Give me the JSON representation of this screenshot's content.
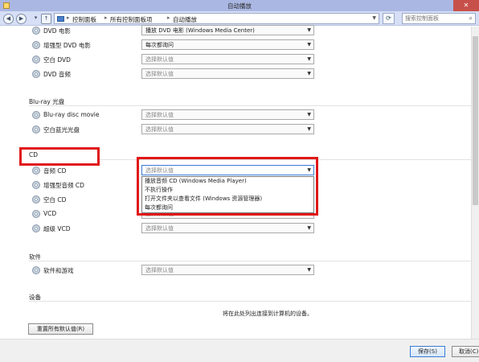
{
  "window": {
    "title": "自动播放"
  },
  "addressbar": {
    "crumbs": [
      "控制面板",
      "所有控制面板项",
      "自动播放"
    ],
    "search_placeholder": "搜索控制面板"
  },
  "dvd_rows": [
    {
      "label": "DVD 电影",
      "value": "播放 DVD 电影 (Windows Media Center)",
      "placeholder": false
    },
    {
      "label": "增强型 DVD 电影",
      "value": "每次都询问",
      "placeholder": false
    },
    {
      "label": "空白 DVD",
      "value": "选择默认值",
      "placeholder": true
    },
    {
      "label": "DVD 音频",
      "value": "选择默认值",
      "placeholder": true
    }
  ],
  "bluray": {
    "heading": "Blu-ray 光盘",
    "rows": [
      {
        "label": "Blu-ray disc movie",
        "value": "选择默认值"
      },
      {
        "label": "空白蓝光光盘",
        "value": "选择默认值"
      }
    ]
  },
  "cd": {
    "heading": "CD",
    "rows": [
      {
        "label": "音频 CD",
        "value": "选择默认值"
      },
      {
        "label": "增强型音频 CD",
        "value": ""
      },
      {
        "label": "空白 CD",
        "value": ""
      },
      {
        "label": "VCD",
        "value": "选择默认值"
      },
      {
        "label": "超级 VCD",
        "value": "选择默认值"
      }
    ],
    "dropdown_options": [
      "播放音频 CD (Windows Media Player)",
      "不执行操作",
      "打开文件夹以查看文件 (Windows 资源管理器)",
      "每次都询问"
    ]
  },
  "software": {
    "heading": "软件",
    "rows": [
      {
        "label": "软件和游戏",
        "value": "选择默认值"
      }
    ]
  },
  "devices": {
    "heading": "设备",
    "info": "将在此处列出连接到计算机的设备。"
  },
  "buttons": {
    "reset": "重置所有默认值(R)",
    "save": "保存(S)",
    "cancel": "取消(C)"
  },
  "icons": {
    "back": "back-arrow-icon",
    "forward": "forward-arrow-icon",
    "up": "up-arrow-icon",
    "folder": "control-panel-folder-icon",
    "refresh": "refresh-icon",
    "search": "search-icon",
    "disc": "disc-icon"
  },
  "colors": {
    "highlight": "#e01818",
    "titlebar": "#aab7e3",
    "focus": "#3b7bd4"
  }
}
